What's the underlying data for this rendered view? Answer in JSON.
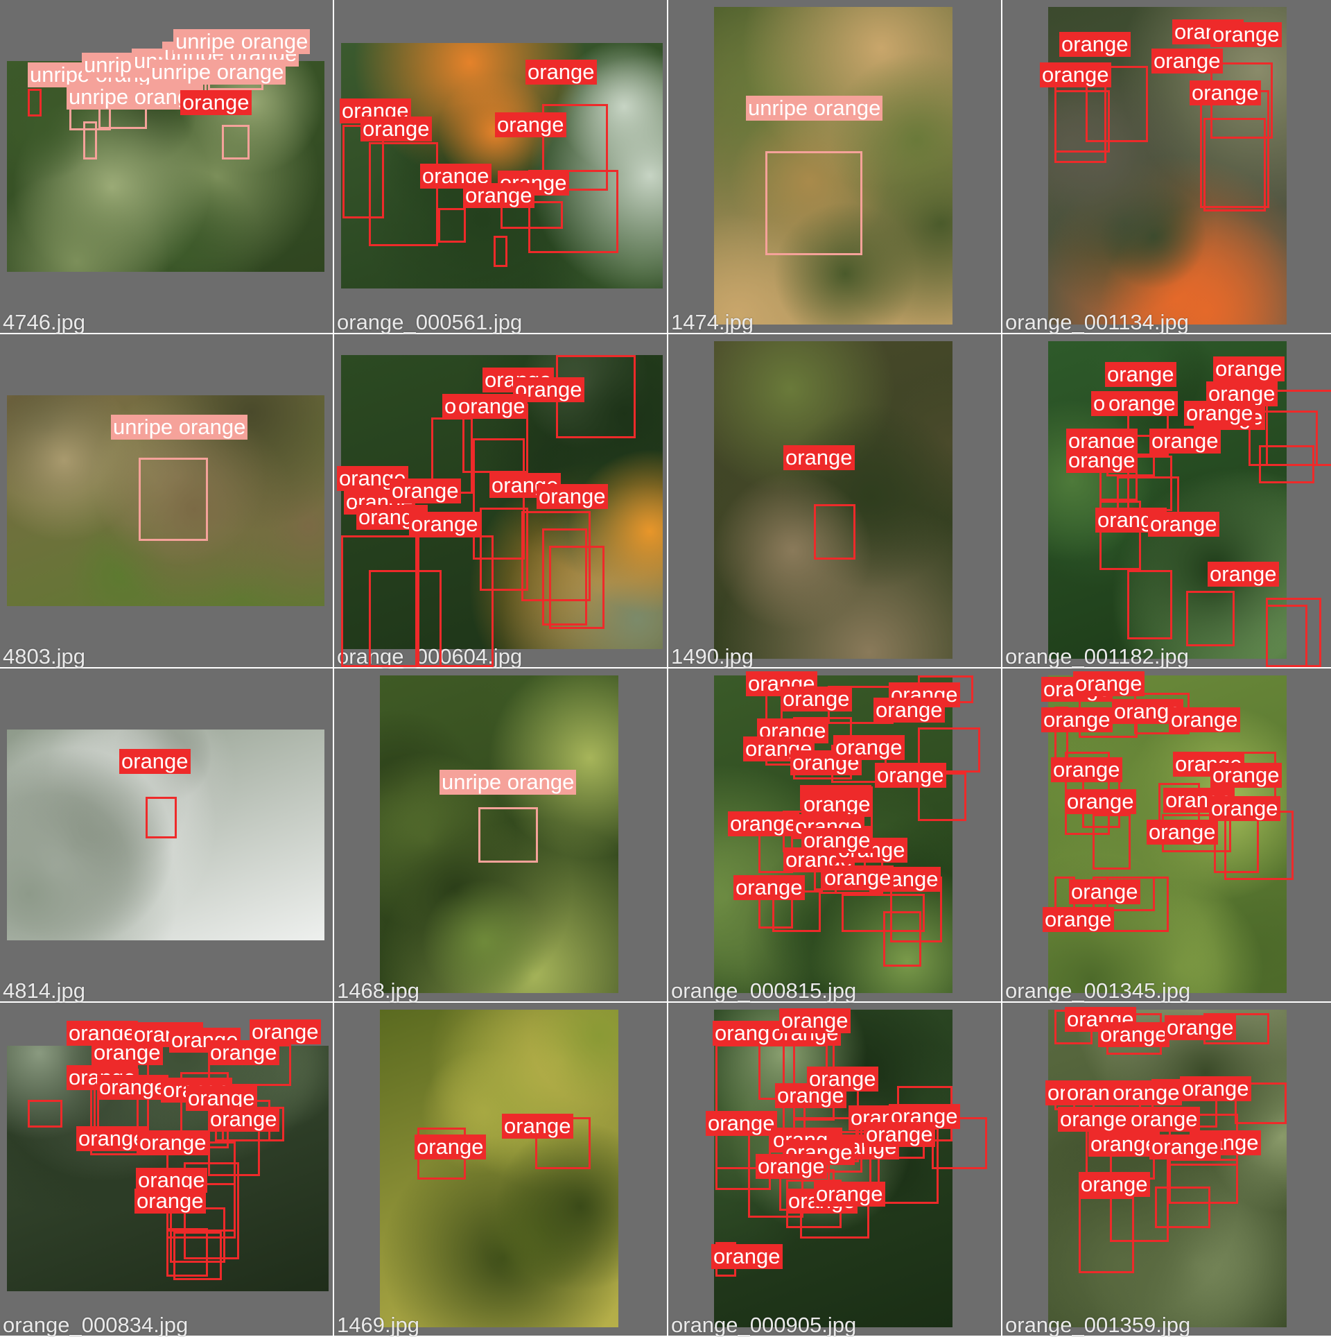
{
  "colors": {
    "orange_class": "#ee2a2a",
    "unripe_class": "#f5a29a",
    "tile_background": "#6d6d6d",
    "filename_text": "#eaeaea"
  },
  "class_names": [
    "orange",
    "unripe orange"
  ],
  "tiles": [
    {
      "filename": "4746.jpg",
      "palette": [
        "#3d5a2a",
        "#7c8f5a",
        "#9fae7a",
        "#2f4520"
      ],
      "detections": [
        "unripe orange",
        "unripe orange",
        "unripe orange",
        "unripe orange",
        "unripe orange",
        "unripe orange",
        "unripe orange",
        "orange"
      ]
    },
    {
      "filename": "orange_000561.jpg",
      "palette": [
        "#3b5a2e",
        "#e5822a",
        "#c7d4c4",
        "#24401d"
      ],
      "detections": [
        "orange",
        "orange",
        "orange",
        "orange",
        "orange",
        "orange",
        "orange"
      ]
    },
    {
      "filename": "1474.jpg",
      "palette": [
        "#4a5a2b",
        "#a98a4b",
        "#6a7a3a",
        "#c9a66b"
      ],
      "detections": [
        "unripe orange"
      ]
    },
    {
      "filename": "orange_001134.jpg",
      "palette": [
        "#3b4a2d",
        "#e4692a",
        "#8a8b6a",
        "#5b5a4a"
      ],
      "detections": [
        "orange",
        "orange",
        "orange",
        "orange",
        "orange",
        "orange"
      ]
    },
    {
      "filename": "4803.jpg",
      "palette": [
        "#7b6a45",
        "#a99a6e",
        "#4a4a2b",
        "#5d7a30"
      ],
      "detections": [
        "unripe orange"
      ]
    },
    {
      "filename": "orange_000604.jpg",
      "palette": [
        "#2c4a22",
        "#e8962a",
        "#7b8a6a",
        "#1d3318"
      ],
      "detections": [
        "orange",
        "orange",
        "orange",
        "orange",
        "orange",
        "orange",
        "orange",
        "orange",
        "orange",
        "orange",
        "orange"
      ]
    },
    {
      "filename": "1490.jpg",
      "palette": [
        "#4a4a2b",
        "#6a7a3a",
        "#8a7a5a",
        "#2f3d1e"
      ],
      "detections": [
        "orange"
      ]
    },
    {
      "filename": "orange_001182.jpg",
      "palette": [
        "#2e5a2a",
        "#4e7a3a",
        "#7fa56a",
        "#1d3a18"
      ],
      "detections": [
        "orange",
        "orange",
        "orange",
        "orange",
        "orange",
        "orange",
        "orange",
        "orange",
        "orange",
        "orange",
        "orange",
        "orange",
        "orange"
      ]
    },
    {
      "filename": "4814.jpg",
      "palette": [
        "#8e9a8a",
        "#c9ccc7",
        "#55624f",
        "#eef0ee"
      ],
      "detections": [
        "orange"
      ]
    },
    {
      "filename": "1468.jpg",
      "palette": [
        "#3f5a25",
        "#6f8a3a",
        "#a7b55a",
        "#2a3d18"
      ],
      "detections": [
        "unripe orange"
      ]
    },
    {
      "filename": "orange_000815.jpg",
      "palette": [
        "#3a5a28",
        "#5d7a3a",
        "#7a9a4a",
        "#24401a"
      ],
      "detections": [
        "orange",
        "orange",
        "orange",
        "orange",
        "orange",
        "orange",
        "orange",
        "orange",
        "orange",
        "orange",
        "orange",
        "orange",
        "orange",
        "orange",
        "orange",
        "orange",
        "orange",
        "orange",
        "orange"
      ]
    },
    {
      "filename": "orange_001345.jpg",
      "palette": [
        "#6b8a3a",
        "#8aa64a",
        "#a8c05a",
        "#4d6a2a"
      ],
      "detections": [
        "orange",
        "orange",
        "orange",
        "orange",
        "orange",
        "orange",
        "orange",
        "orange",
        "orange",
        "orange",
        "orange",
        "orange",
        "orange",
        "orange"
      ]
    },
    {
      "filename": "orange_000834.jpg",
      "palette": [
        "#3d4f35",
        "#8a9a80",
        "#5d6f50",
        "#1f2d1a"
      ],
      "detections": [
        "orange",
        "orange",
        "orange",
        "orange",
        "orange",
        "orange",
        "orange",
        "orange",
        "orange",
        "orange",
        "orange",
        "orange",
        "orange",
        "orange",
        "orange"
      ]
    },
    {
      "filename": "1469.jpg",
      "palette": [
        "#5a6a20",
        "#8a9a35",
        "#3a4a18",
        "#b7b04a"
      ],
      "detections": [
        "orange",
        "orange"
      ]
    },
    {
      "filename": "orange_000905.jpg",
      "palette": [
        "#2e4a25",
        "#4e6a3a",
        "#8aa070",
        "#1a2e15"
      ],
      "detections": [
        "orange",
        "orange",
        "orange",
        "orange",
        "orange",
        "orange",
        "orange",
        "orange",
        "orange",
        "orange",
        "orange",
        "orange",
        "orange",
        "orange",
        "orange",
        "orange"
      ]
    },
    {
      "filename": "orange_001359.jpg",
      "palette": [
        "#5a6a40",
        "#8a9a6a",
        "#aab08a",
        "#3a4a28"
      ],
      "detections": [
        "orange",
        "orange",
        "orange",
        "orange",
        "orange",
        "orange",
        "orange",
        "orange",
        "orange",
        "orange",
        "orange",
        "orange",
        "orange"
      ]
    }
  ]
}
